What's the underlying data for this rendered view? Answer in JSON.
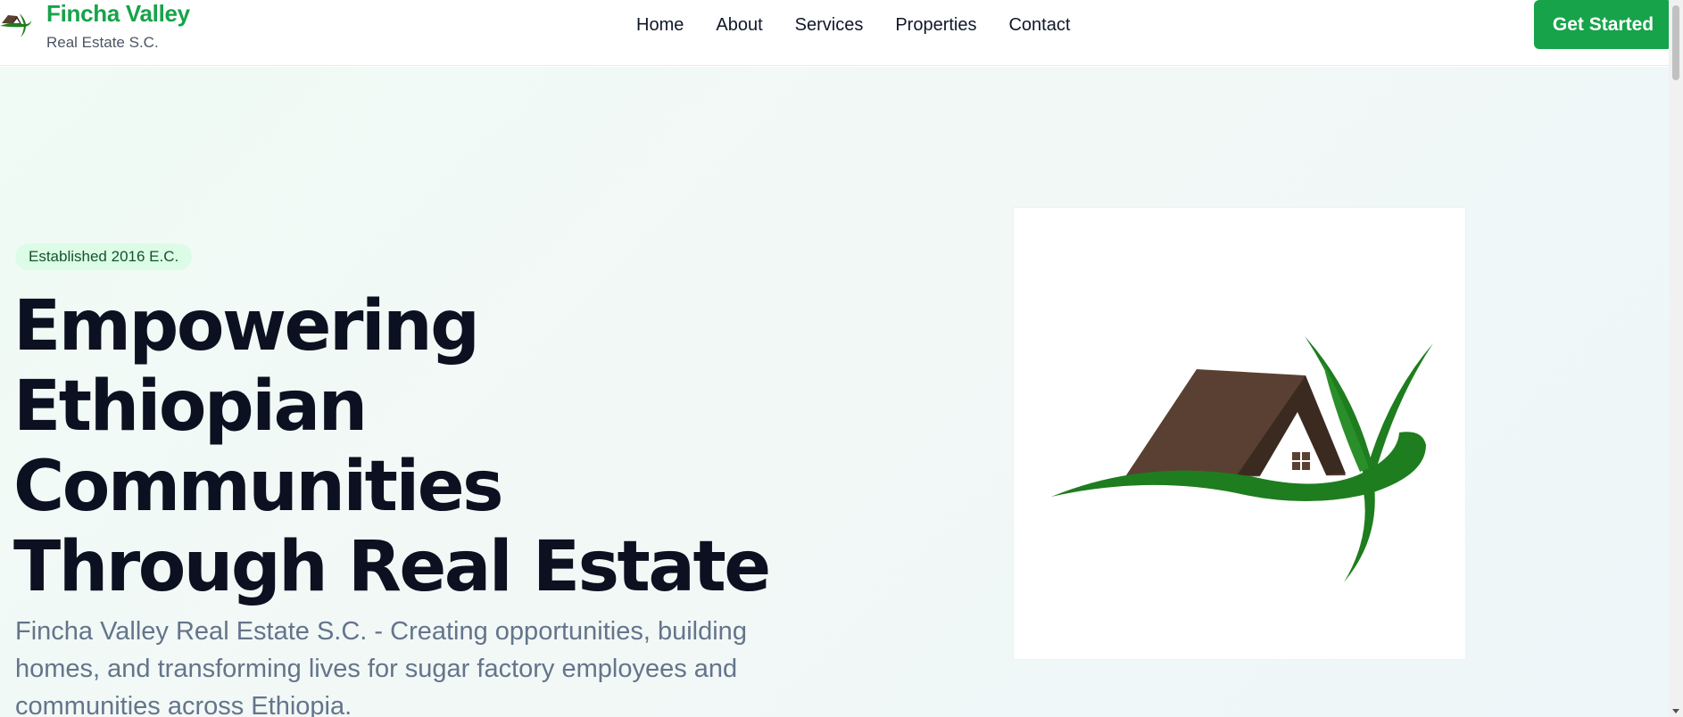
{
  "header": {
    "brand_name": "Fincha Valley",
    "brand_subtitle": "Real Estate S.C.",
    "logo_icon": "house-with-leaves-icon",
    "nav": [
      {
        "label": "Home"
      },
      {
        "label": "About"
      },
      {
        "label": "Services"
      },
      {
        "label": "Properties"
      },
      {
        "label": "Contact"
      }
    ],
    "cta_label": "Get Started"
  },
  "hero": {
    "badge": "Established 2016 E.C.",
    "headline_lines": [
      "Empowering",
      "Ethiopian",
      "Communities",
      "Through Real Estate"
    ],
    "lead": "Fincha Valley Real Estate S.C. - Creating opportunities, building homes, and transforming lives for sugar factory employees and communities across Ethiopia.",
    "image_icon": "house-with-leaves-logo"
  },
  "colors": {
    "brand_green": "#16a34a",
    "badge_bg": "#dcfce7",
    "headline": "#0b1120",
    "roof_brown": "#5a4032",
    "leaf_green": "#1e7d1e"
  }
}
